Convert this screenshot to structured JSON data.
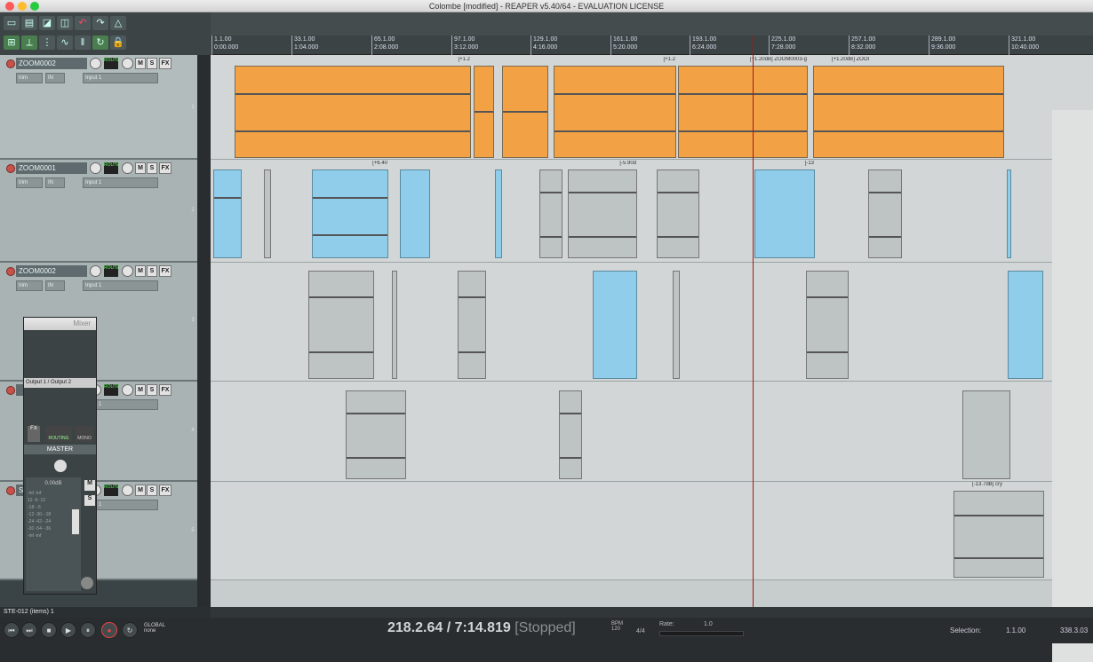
{
  "window": {
    "title": "Colombe [modified] - REAPER v5.40/64 - EVALUATION LICENSE"
  },
  "ruler": {
    "markers": [
      {
        "bar": "1.1.00",
        "time": "0:00.000"
      },
      {
        "bar": "33.1.00",
        "time": "1:04.000"
      },
      {
        "bar": "65.1.00",
        "time": "2:08.000"
      },
      {
        "bar": "97.1.00",
        "time": "3:12.000"
      },
      {
        "bar": "129.1.00",
        "time": "4:16.000"
      },
      {
        "bar": "161.1.00",
        "time": "5:20.000"
      },
      {
        "bar": "193.1.00",
        "time": "6:24.000"
      },
      {
        "bar": "225.1.00",
        "time": "7:28.000"
      },
      {
        "bar": "257.1.00",
        "time": "8:32.000"
      },
      {
        "bar": "289.1.00",
        "time": "9:36.000"
      },
      {
        "bar": "321.1.00",
        "time": "10:40.000"
      }
    ]
  },
  "tracks": [
    {
      "name": "ZOOM0002",
      "num": "1",
      "input": "Input 1"
    },
    {
      "name": "ZOOM0001",
      "num": "2",
      "input": "Input 1"
    },
    {
      "name": "ZOOM0002",
      "num": "3",
      "input": "Input 1"
    },
    {
      "name": "",
      "num": "4",
      "input": "Input 1"
    },
    {
      "name": "S",
      "num": "5",
      "input": "Input 1"
    }
  ],
  "track_controls": {
    "route": "ROUTE",
    "mute": "M",
    "solo": "S",
    "fx": "FX",
    "trim": "trim",
    "in": "IN"
  },
  "items": {
    "t1_a": "[+1.2",
    "t1_b": "[+1.2",
    "t1_c": "[+1.20dB] ZOOM0003-g",
    "t1_d": "[+1.20dB] ZOOI",
    "t2_a": "[+6.40",
    "t2_b": "[-5.90d",
    "t2_c": "[-13",
    "t5_a": "[-13.7dB] cry"
  },
  "mixer": {
    "title": "Mixer",
    "io": "Output 1 / Output 2",
    "fx": "FX",
    "routing": "ROUTING",
    "mono": "MONO",
    "master": "MASTER",
    "gain": "0.00dB",
    "mute": "M",
    "solo": "S",
    "meter_labels": [
      "-inf",
      "-inf",
      "12",
      "-6-",
      "12",
      "-18-",
      "-6",
      "-12",
      "-30-",
      "-18",
      "-24",
      "-42-",
      "-24",
      "-30",
      "-54-",
      "-36",
      "-inf",
      "-inf"
    ]
  },
  "status": {
    "items": "STE-012 (items) 1"
  },
  "transport": {
    "position": "218.2.64 / 7:14.819",
    "state": "[Stopped]",
    "bpm_label": "BPM",
    "bpm": "120",
    "timesig": "4/4",
    "rate_label": "Rate:",
    "rate": "1.0",
    "global_label": "GLOBAL",
    "global_value": "none",
    "selection_label": "Selection:",
    "selection_start": "1.1.00",
    "selection_end": "338.3.03"
  },
  "colors": {
    "orange_item": "#f2a145",
    "blue_item": "#8fcdeb",
    "grey_item": "#bec3c3",
    "cursor": "#a31818"
  }
}
